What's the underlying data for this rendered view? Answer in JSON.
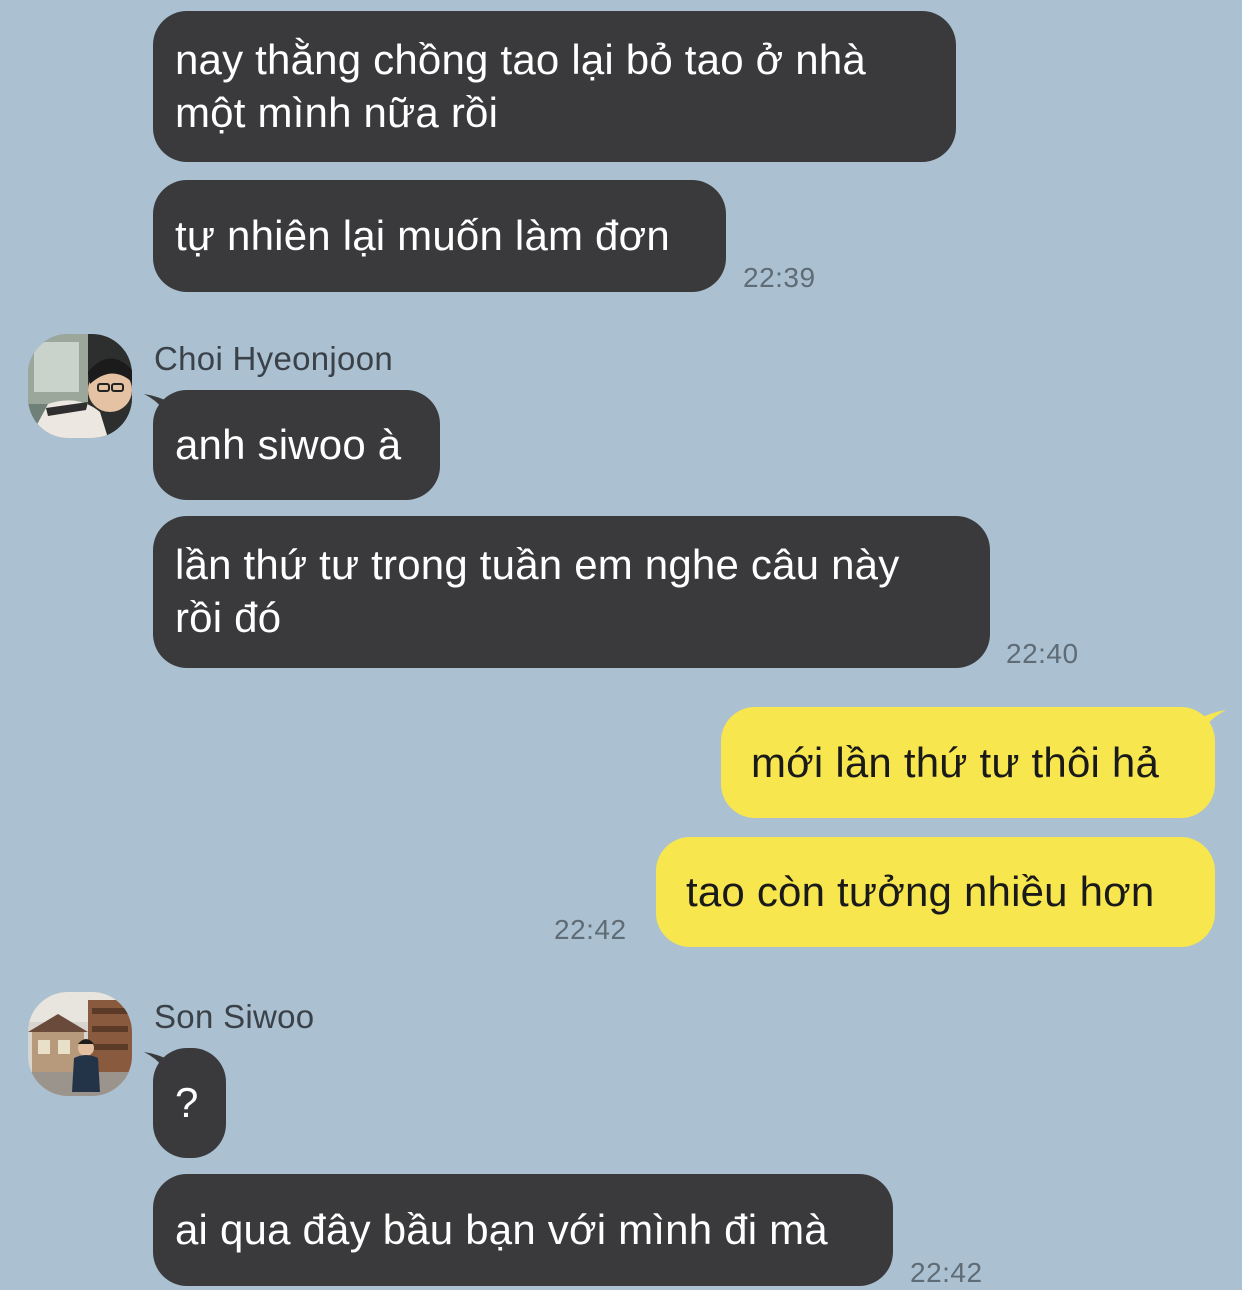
{
  "messages": {
    "m1": {
      "text": "nay thằng chồng tao lại bỏ tao ở nhà\nmột mình nữa rồi"
    },
    "m2": {
      "text": "tự nhiên lại muốn làm đơn",
      "time": "22:39"
    },
    "group2": {
      "sender": "Choi Hyeonjoon"
    },
    "m3": {
      "text": "anh siwoo à"
    },
    "m4": {
      "text": "lần thứ tư trong tuần em nghe câu này\nrồi đó",
      "time": "22:40"
    },
    "m5": {
      "text": "mới lần thứ tư thôi hả"
    },
    "m6": {
      "text": "tao còn tưởng nhiều hơn",
      "time": "22:42"
    },
    "group4": {
      "sender": "Son Siwoo"
    },
    "m7": {
      "text": "?"
    },
    "m8": {
      "text": "ai qua đây bầu bạn với mình đi mà",
      "time": "22:42"
    }
  },
  "colors": {
    "background": "#abc1d1",
    "incoming_bubble": "#3a3a3c",
    "outgoing_bubble": "#f7e64e"
  },
  "icons": [
    "avatar-choi-hyeonjoon",
    "avatar-son-siwoo"
  ]
}
